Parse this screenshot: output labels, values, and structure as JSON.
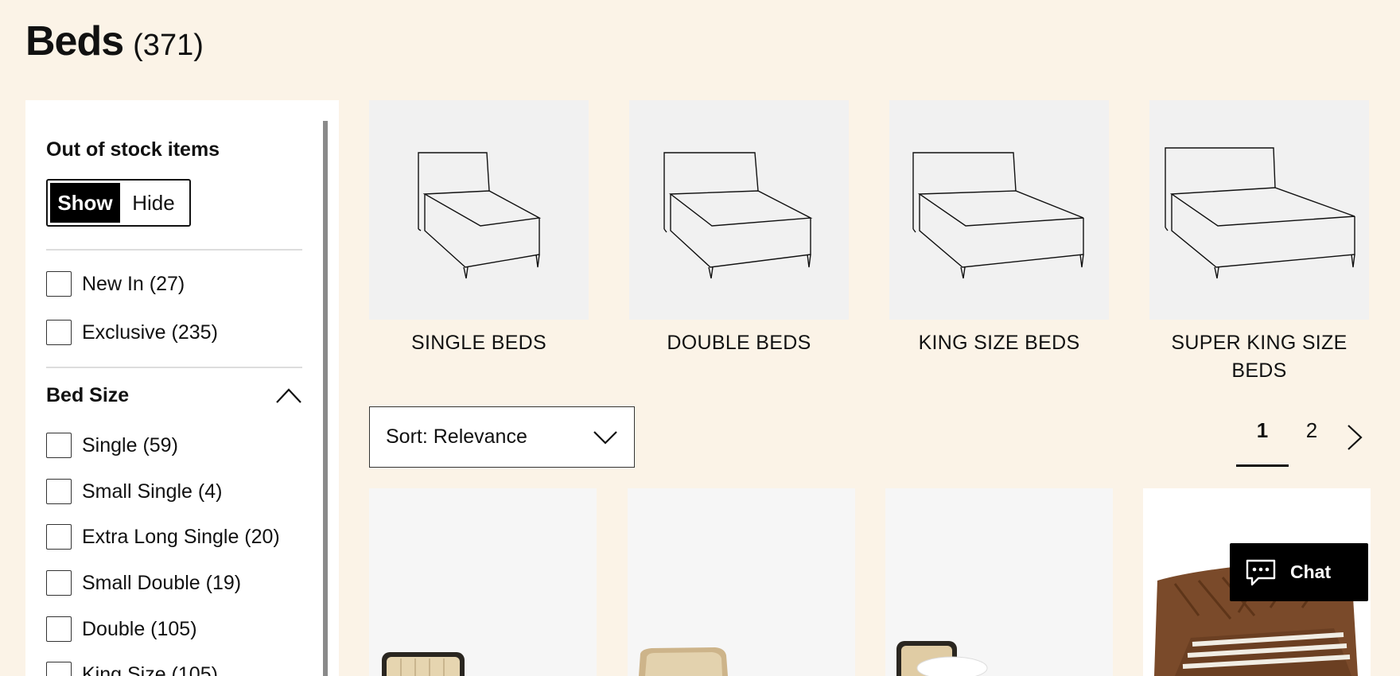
{
  "page": {
    "title": "Beds",
    "count": "(371)"
  },
  "sidebar": {
    "stock_heading": "Out of stock items",
    "toggle": {
      "show": "Show",
      "hide": "Hide"
    },
    "filters": [
      {
        "label": "New In (27)"
      },
      {
        "label": "Exclusive (235)"
      }
    ],
    "bed_size": {
      "heading": "Bed Size",
      "options": [
        {
          "label": "Single (59)"
        },
        {
          "label": "Small Single (4)"
        },
        {
          "label": "Extra Long Single (20)"
        },
        {
          "label": "Small Double (19)"
        },
        {
          "label": "Double (105)"
        },
        {
          "label": "King Size (105)"
        }
      ]
    }
  },
  "categories": [
    {
      "label": "SINGLE BEDS",
      "icon": "single-bed-outline"
    },
    {
      "label": "DOUBLE BEDS",
      "icon": "double-bed-outline"
    },
    {
      "label": "KING SIZE BEDS",
      "icon": "king-bed-outline"
    },
    {
      "label": "SUPER KING SIZE BEDS",
      "icon": "super-king-bed-outline"
    }
  ],
  "sort": {
    "label": "Sort: Relevance"
  },
  "pagination": {
    "current": "1",
    "next_page": "2"
  },
  "chat": {
    "label": "Chat"
  },
  "colors": {
    "background": "#fbf3e7",
    "tile": "#f1f1f1",
    "accent": "#000000"
  }
}
